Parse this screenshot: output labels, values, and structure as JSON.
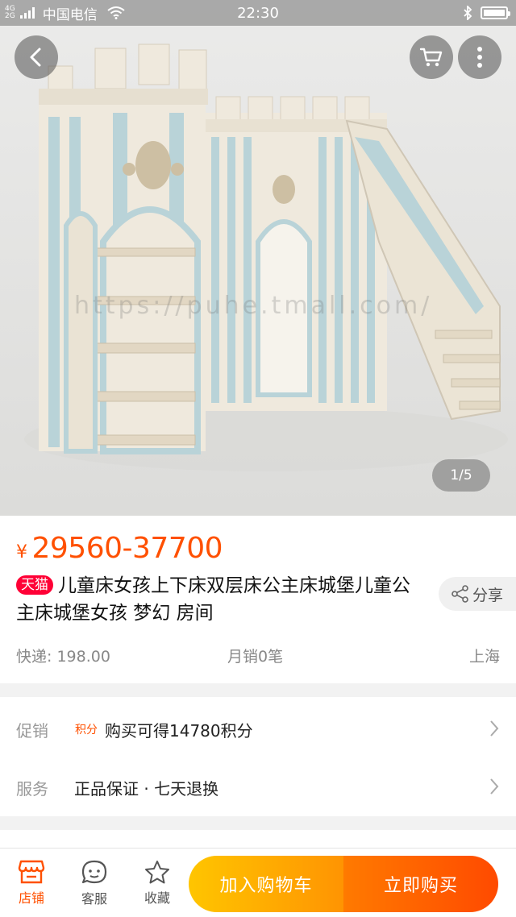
{
  "status_bar": {
    "network": "4G",
    "network2": "2G",
    "carrier": "中国电信",
    "time": "22:30"
  },
  "hero": {
    "image_counter": "1/5",
    "watermark": "https://puhe.tmall.com/"
  },
  "product": {
    "price_currency": "¥",
    "price_range": "29560-37700",
    "store_tag": "天猫",
    "title": "儿童床女孩上下床双层床公主床城堡儿童公主床城堡女孩 梦幻 房间",
    "share_label": "分享",
    "shipping": "快递: 198.00",
    "monthly_sales": "月销0笔",
    "location": "上海"
  },
  "promo": {
    "label": "促销",
    "points_tag": "积分",
    "text": "购买可得14780积分"
  },
  "service": {
    "label": "服务",
    "text": "正品保证 · 七天退换"
  },
  "bottom_bar": {
    "store": "店铺",
    "customer_service": "客服",
    "favorite": "收藏",
    "add_to_cart": "加入购物车",
    "buy_now": "立即购买"
  },
  "colors": {
    "accent": "#ff5000",
    "tmall": "#ff0036",
    "cart_button": "#ffa200",
    "buy_button": "#ff5a00"
  }
}
